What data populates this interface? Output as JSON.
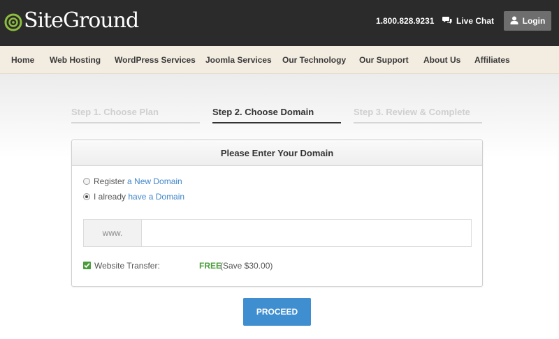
{
  "brand": {
    "logo_text": "SiteGround",
    "logo_color": "#8dbe3f"
  },
  "topbar": {
    "phone": "1.800.828.9231",
    "live_chat": {
      "label": "Live Chat",
      "icon": "chat-bubbles-icon"
    },
    "login": {
      "label": "Login",
      "icon": "user-icon"
    }
  },
  "nav": {
    "items": [
      {
        "label": "Home"
      },
      {
        "label": "Web Hosting"
      },
      {
        "label": "WordPress Services"
      },
      {
        "label": "Joomla Services"
      },
      {
        "label": "Our Technology"
      },
      {
        "label": "Our Support"
      },
      {
        "label": "About Us"
      },
      {
        "label": "Affiliates"
      }
    ]
  },
  "steps": [
    {
      "label": "Step 1. Choose Plan",
      "state": "inactive"
    },
    {
      "label": "Step 2. Choose Domain",
      "state": "active"
    },
    {
      "label": "Step 3. Review & Complete",
      "state": "inactive"
    }
  ],
  "panel": {
    "title": "Please Enter Your Domain",
    "options": [
      {
        "prefix": "Register ",
        "link": "a New Domain",
        "checked": false
      },
      {
        "prefix": "I already ",
        "link": "have a Domain",
        "checked": true
      }
    ],
    "domain": {
      "prefix": "www.",
      "value": "",
      "placeholder": ""
    },
    "transfer": {
      "label": "Website Transfer:",
      "checked": true,
      "price": "FREE",
      "note": "(Save $30.00)"
    }
  },
  "actions": {
    "proceed": "PROCEED"
  },
  "colors": {
    "topbar_bg": "#2b2b2b",
    "nav_bg": "#f3ece1",
    "accent_blue": "#3f8ed0",
    "free_green": "#4a9e3a"
  }
}
